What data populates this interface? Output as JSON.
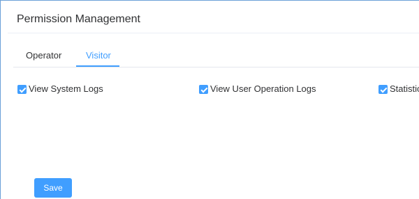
{
  "panel": {
    "title": "Permission Management"
  },
  "tabs": [
    {
      "label": "Operator",
      "active": false
    },
    {
      "label": "Visitor",
      "active": true
    }
  ],
  "permissions": [
    {
      "label": "View System Logs",
      "checked": true
    },
    {
      "label": "View User Operation Logs",
      "checked": true
    },
    {
      "label": "Statistics",
      "checked": true
    }
  ],
  "actions": {
    "save_label": "Save"
  },
  "colors": {
    "accent": "#409eff",
    "text": "#303133",
    "border": "#e4e7ed",
    "frame_border": "#6aa0d8"
  }
}
